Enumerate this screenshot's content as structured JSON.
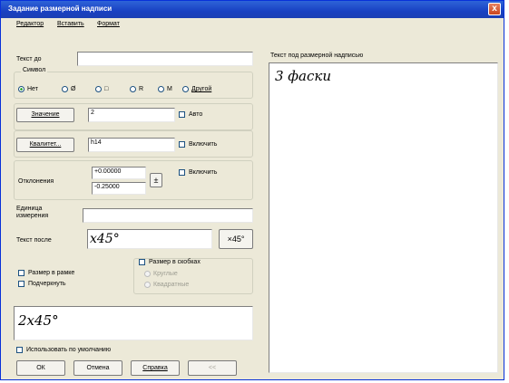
{
  "window": {
    "title": "Задание размерной надписи",
    "close_label": "x"
  },
  "menu": [
    "Редактор",
    "Вставить",
    "Формат"
  ],
  "text_before": {
    "label": "Текст до",
    "value": ""
  },
  "symbol": {
    "label": "Символ",
    "options": [
      "Нет",
      "Ø",
      "□",
      "R",
      "M",
      "Другой"
    ],
    "selected": 0
  },
  "value_row": {
    "button": "Значение",
    "value": "2",
    "auto_label": "Авто"
  },
  "tolerance_row": {
    "button": "Квалитет...",
    "value": "h14",
    "include_label": "Включить"
  },
  "deviations_row": {
    "label": "Отклонения",
    "upper": "+0.00000",
    "lower": "-0.25000",
    "pm_symbol": "±",
    "include_label": "Включить"
  },
  "unit": {
    "label": "Единица измерения",
    "value": ""
  },
  "text_after": {
    "label": "Текст после",
    "value": "x45°",
    "button": "×45°"
  },
  "size_frame": {
    "label": "Размер в рамке"
  },
  "underline": {
    "label": "Подчеркнуть"
  },
  "parentheses": {
    "label": "Размер в скобках",
    "opt1": "Круглые",
    "opt2": "Квадратные"
  },
  "preview": {
    "text": "2x45°"
  },
  "use_default": {
    "label": "Использовать по умолчанию"
  },
  "footer": {
    "ok": "ОК",
    "cancel": "Отмена",
    "help": "Справка",
    "extra": "<<"
  },
  "under_text": {
    "label": "Текст под размерной надписью",
    "value": "3 фаски"
  }
}
